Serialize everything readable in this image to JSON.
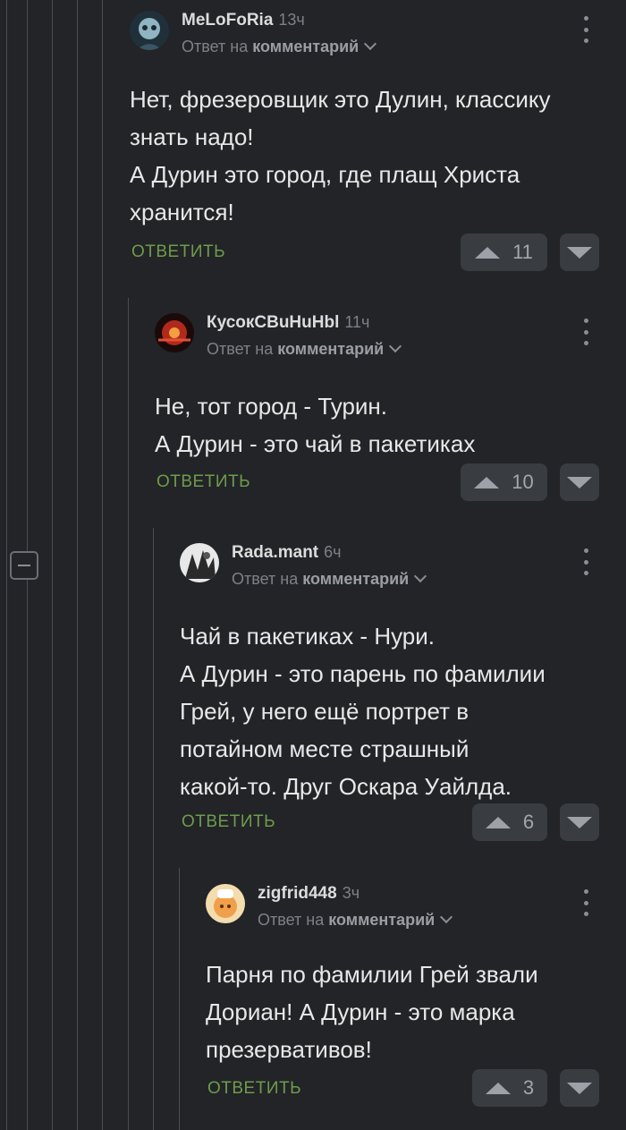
{
  "comments": [
    {
      "username": "MeLoFoRia",
      "time": "13ч",
      "reply_prefix": "Ответ на",
      "reply_target": "комментарий",
      "text_lines": [
        "Нет, фрезеровщик это Дулин, классику",
        "знать надо!",
        "А Дурин это город, где плащ Христа",
        "хранится!"
      ],
      "reply_label": "ОТВЕТИТЬ",
      "rating": "11"
    },
    {
      "username": "КусокСВuHuHbl",
      "time": "11ч",
      "reply_prefix": "Ответ на",
      "reply_target": "комментарий",
      "text_lines": [
        "Не, тот город - Турин.",
        "А Дурин - это чай в пакетиках"
      ],
      "reply_label": "ОТВЕТИТЬ",
      "rating": "10"
    },
    {
      "username": "Rada.mant",
      "time": "6ч",
      "reply_prefix": "Ответ на",
      "reply_target": "комментарий",
      "text_lines": [
        "Чай в пакетиках - Нури.",
        "А Дурин - это парень по фамилии",
        "Грей, у него ещё портрет в",
        "потайном месте страшный",
        "какой-то. Друг Оскара Уайлда."
      ],
      "reply_label": "ОТВЕТИТЬ",
      "rating": "6"
    },
    {
      "username": "zigfrid448",
      "time": "3ч",
      "reply_prefix": "Ответ на",
      "reply_target": "комментарий",
      "text_lines": [
        "Парня по фамилии Грей звали",
        "Дориан! А Дурин - это марка",
        "презервативов!"
      ],
      "reply_label": "ОТВЕТИТЬ",
      "rating": "3"
    }
  ],
  "colors": {
    "background": "#222427",
    "reply_green": "#6f9b4c",
    "muted": "#7d8187"
  },
  "icons": [
    "kebab-menu-icon",
    "chevron-down-icon",
    "upvote-icon",
    "downvote-icon",
    "collapse-icon"
  ]
}
